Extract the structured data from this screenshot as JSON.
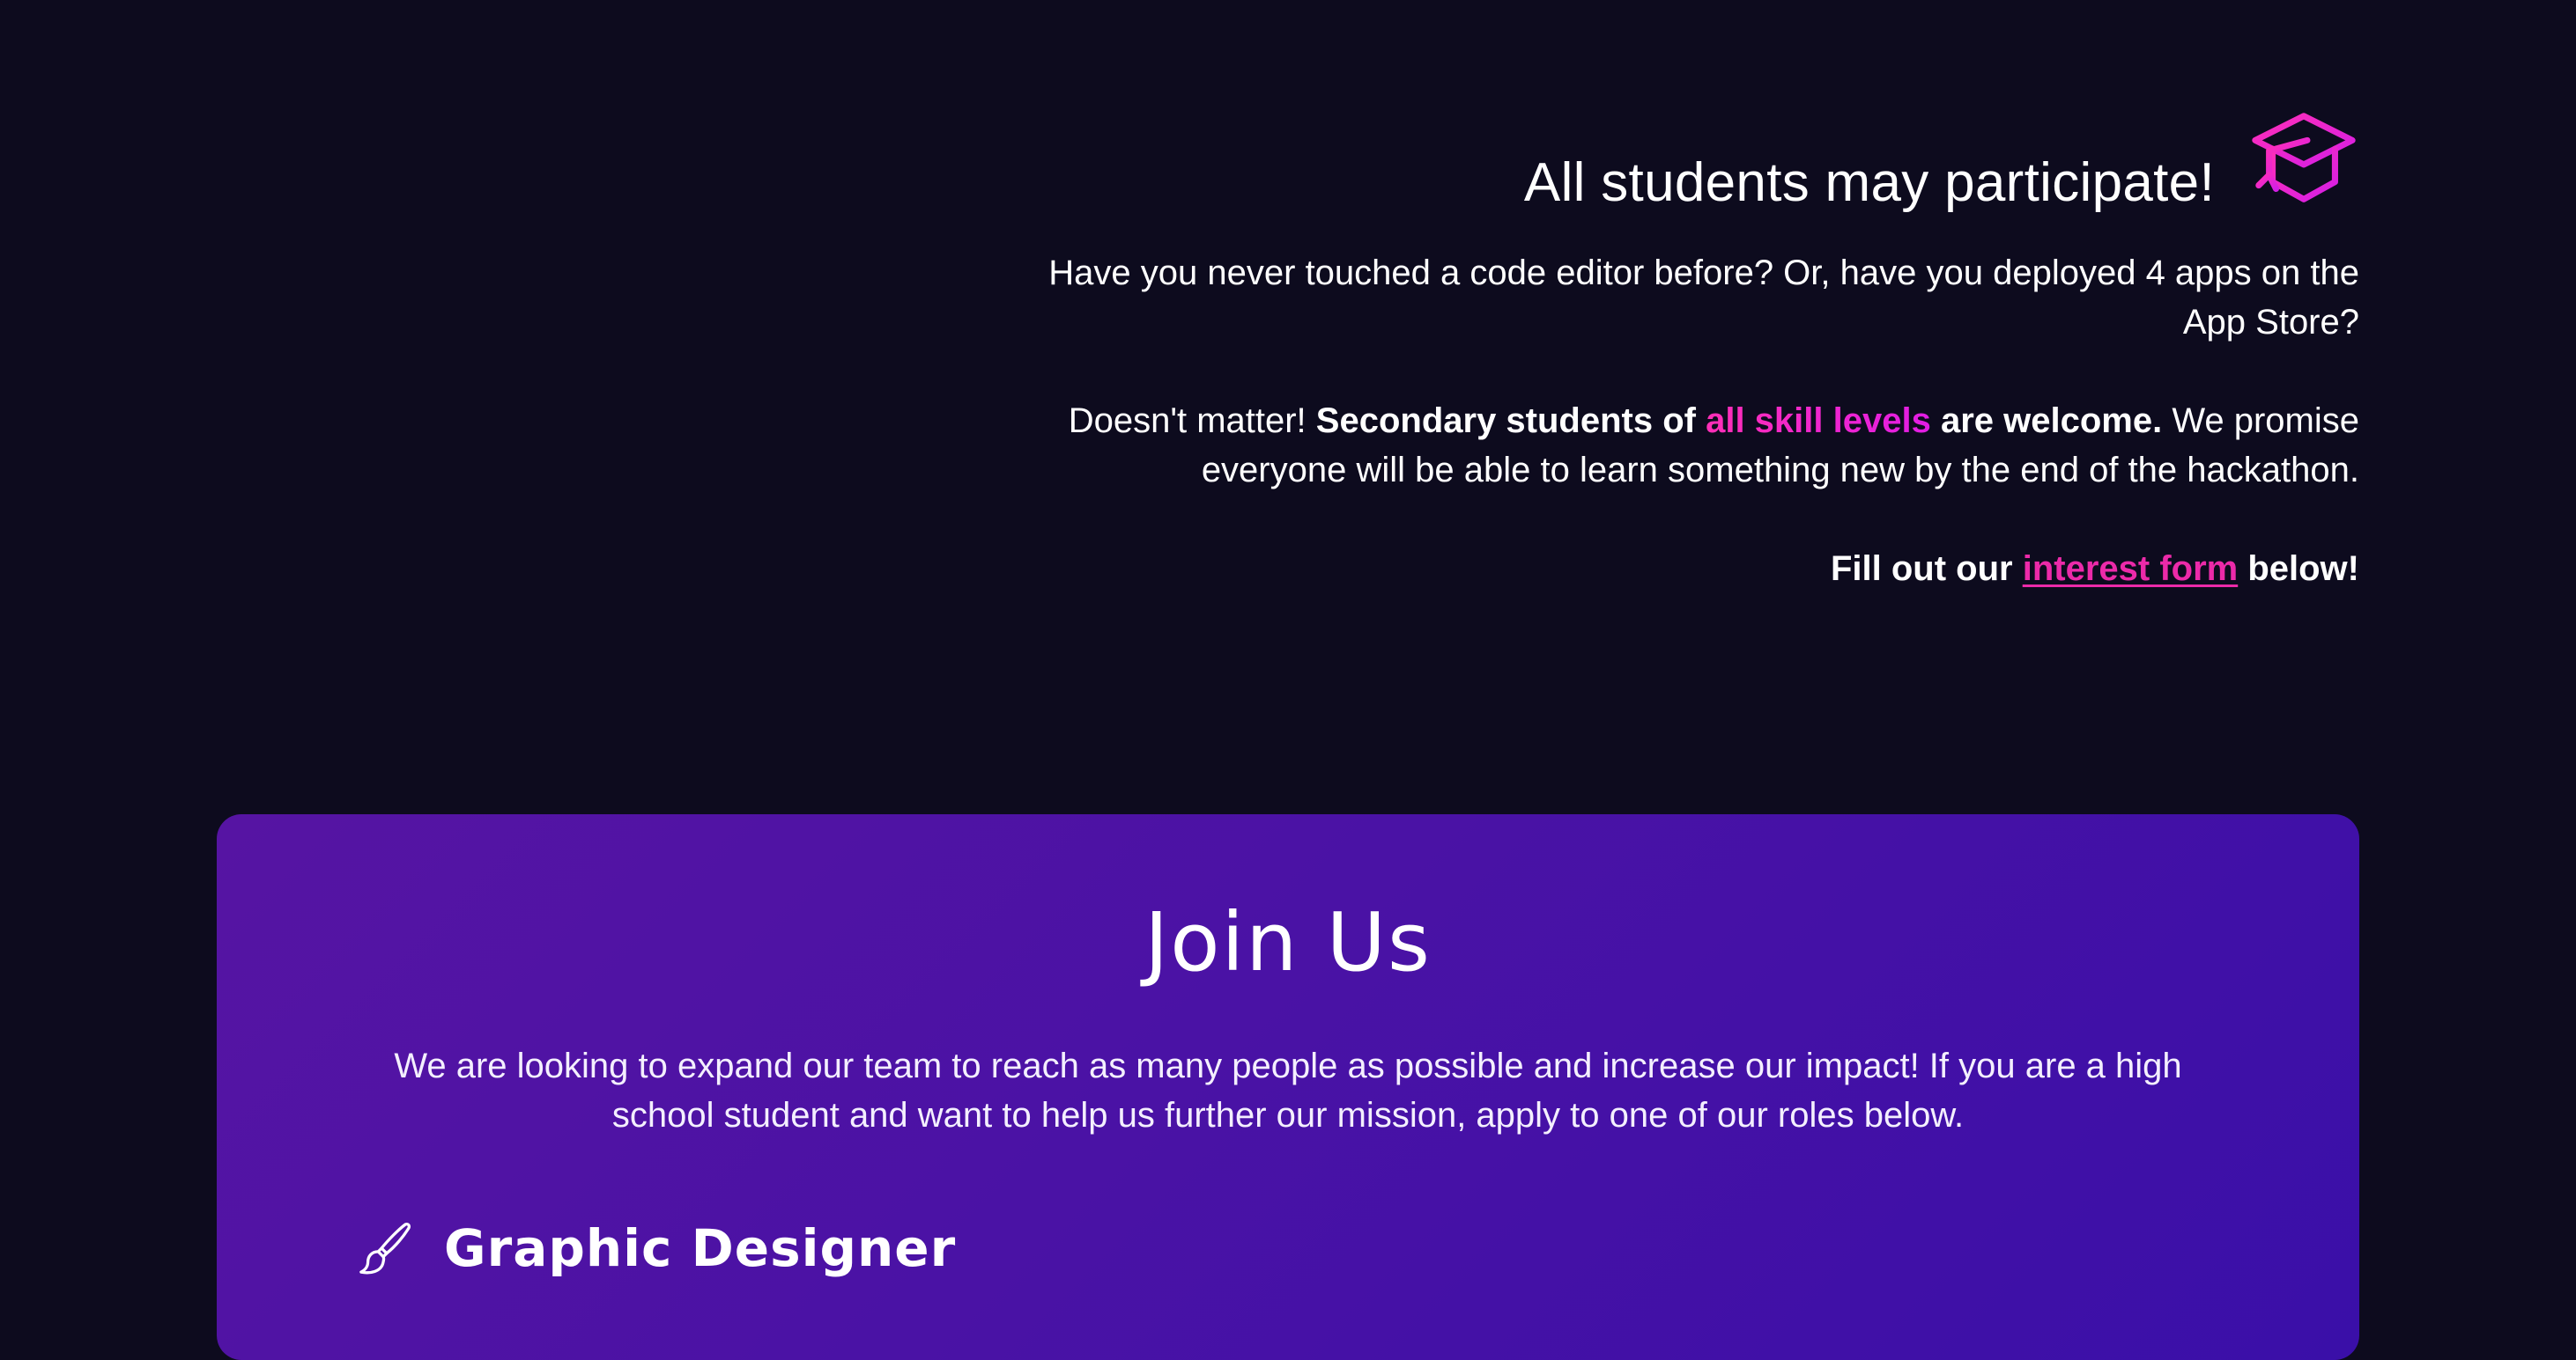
{
  "participate": {
    "title": "All students may participate!",
    "icon": "graduation-cap-icon",
    "intro": "Have you never touched a code editor before? Or, have you deployed 4 apps on the App Store?",
    "body_lead": "Doesn't matter! ",
    "body_strong_1": "Secondary students of ",
    "body_highlight": "all skill levels",
    "body_strong_2": " are welcome.",
    "body_rest": " We promise everyone will be able to learn something new by the end of the hackathon.",
    "cta_prefix": "Fill out our ",
    "cta_link": "interest form",
    "cta_suffix": " below!"
  },
  "join": {
    "title": "Join Us",
    "description": "We are looking to expand our team to reach as many people as possible and increase our impact! If you are a high school student and want to help us further our mission, apply to one of our roles below.",
    "roles": [
      {
        "icon": "paintbrush-icon",
        "title": "Graphic Designer"
      }
    ]
  },
  "colors": {
    "background": "#0d0b1e",
    "accent_pink": "#ec1fd6",
    "link_pink": "#ec2aa9",
    "card_gradient_start": "#5614a3",
    "card_gradient_end": "#3a0fa8"
  }
}
